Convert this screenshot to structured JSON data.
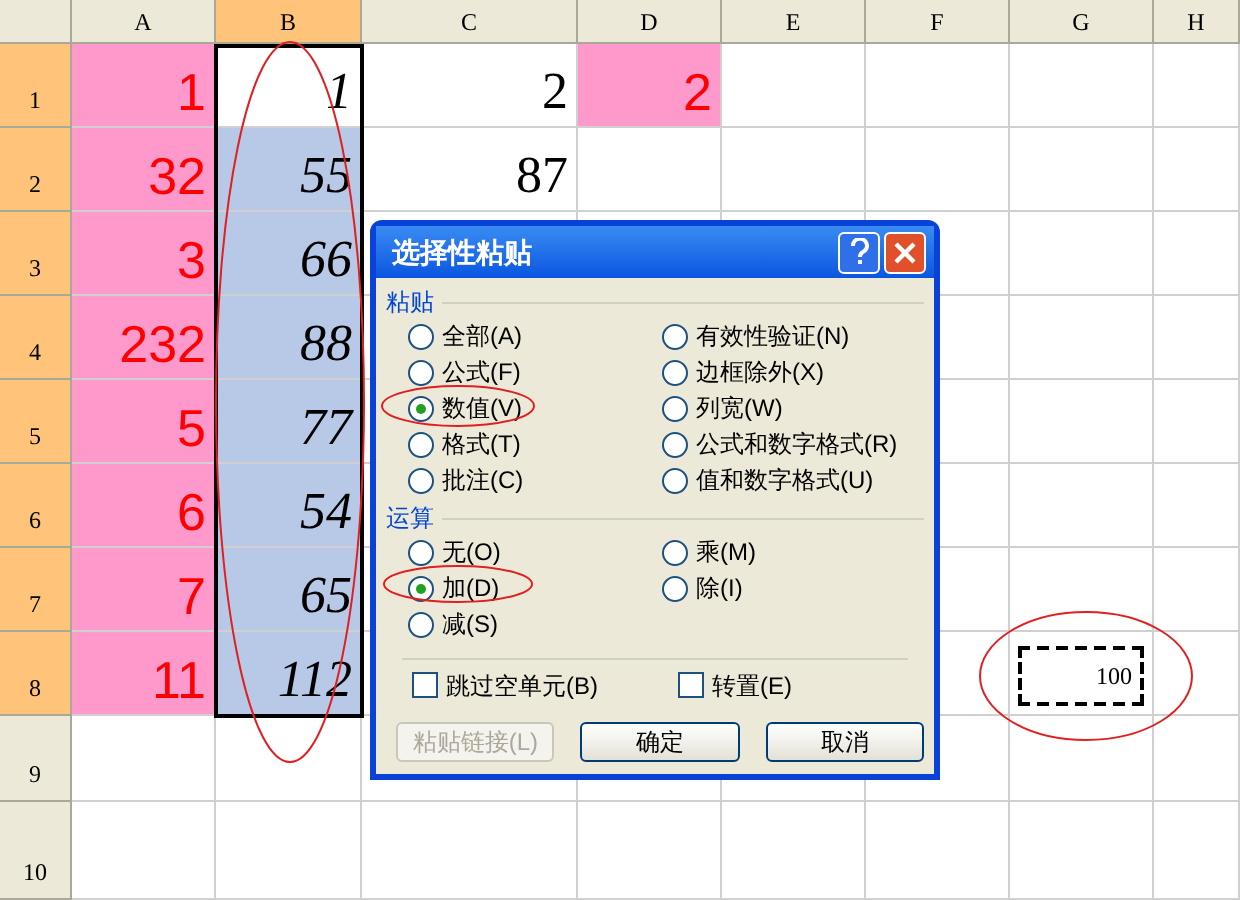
{
  "sheet": {
    "columns": [
      {
        "label": "A",
        "selected": false
      },
      {
        "label": "B",
        "selected": true
      },
      {
        "label": "C",
        "selected": false
      },
      {
        "label": "D",
        "selected": false
      },
      {
        "label": "E",
        "selected": false
      },
      {
        "label": "F",
        "selected": false
      },
      {
        "label": "G",
        "selected": false
      },
      {
        "label": "H",
        "selected": false
      }
    ],
    "rows": [
      {
        "label": "1",
        "selected": true,
        "cells": [
          {
            "kind": "highlight",
            "text": "1"
          },
          {
            "kind": "italic",
            "text": "1",
            "selected": false
          },
          {
            "kind": "number",
            "text": "2"
          },
          {
            "kind": "highlight",
            "text": "2"
          }
        ]
      },
      {
        "label": "2",
        "selected": true,
        "cells": [
          {
            "kind": "highlight",
            "text": "32"
          },
          {
            "kind": "italic",
            "text": "55",
            "selected": true
          },
          {
            "kind": "number",
            "text": "87"
          }
        ]
      },
      {
        "label": "3",
        "selected": true,
        "cells": [
          {
            "kind": "highlight",
            "text": "3"
          },
          {
            "kind": "italic",
            "text": "66",
            "selected": true
          }
        ]
      },
      {
        "label": "4",
        "selected": true,
        "cells": [
          {
            "kind": "highlight",
            "text": "232"
          },
          {
            "kind": "italic",
            "text": "88",
            "selected": true
          }
        ]
      },
      {
        "label": "5",
        "selected": true,
        "cells": [
          {
            "kind": "highlight",
            "text": "5"
          },
          {
            "kind": "italic",
            "text": "77",
            "selected": true
          }
        ]
      },
      {
        "label": "6",
        "selected": true,
        "cells": [
          {
            "kind": "highlight",
            "text": "6"
          },
          {
            "kind": "italic",
            "text": "54",
            "selected": true
          }
        ]
      },
      {
        "label": "7",
        "selected": true,
        "cells": [
          {
            "kind": "highlight",
            "text": "7"
          },
          {
            "kind": "italic",
            "text": "65",
            "selected": true
          }
        ]
      },
      {
        "label": "8",
        "selected": true,
        "cells": [
          {
            "kind": "highlight",
            "text": "11"
          },
          {
            "kind": "italic",
            "text": "112",
            "selected": true
          },
          {
            "kind": "empty"
          },
          {
            "kind": "empty"
          },
          {
            "kind": "empty"
          },
          {
            "kind": "empty"
          },
          {
            "kind": "copied",
            "text": "100"
          }
        ]
      },
      {
        "label": "9",
        "selected": false,
        "cells": []
      },
      {
        "label": "10",
        "selected": false,
        "cells": []
      }
    ]
  },
  "dialog": {
    "title": "选择性粘贴",
    "paste_group": {
      "label": "粘贴",
      "options": [
        {
          "label": "全部(A)",
          "selected": false
        },
        {
          "label": "有效性验证(N)",
          "selected": false
        },
        {
          "label": "公式(F)",
          "selected": false
        },
        {
          "label": "边框除外(X)",
          "selected": false
        },
        {
          "label": "数值(V)",
          "selected": true
        },
        {
          "label": "列宽(W)",
          "selected": false
        },
        {
          "label": "格式(T)",
          "selected": false
        },
        {
          "label": "公式和数字格式(R)",
          "selected": false
        },
        {
          "label": "批注(C)",
          "selected": false
        },
        {
          "label": "值和数字格式(U)",
          "selected": false
        }
      ]
    },
    "operation_group": {
      "label": "运算",
      "options": [
        {
          "label": "无(O)",
          "selected": false
        },
        {
          "label": "乘(M)",
          "selected": false
        },
        {
          "label": "加(D)",
          "selected": true
        },
        {
          "label": "除(I)",
          "selected": false
        },
        {
          "label": "减(S)",
          "selected": false
        }
      ]
    },
    "checkboxes": [
      {
        "label": "跳过空单元(B)",
        "checked": false
      },
      {
        "label": "转置(E)",
        "checked": false
      }
    ],
    "buttons": [
      {
        "label": "粘贴链接(L)",
        "disabled": true
      },
      {
        "label": "确定",
        "disabled": false
      },
      {
        "label": "取消",
        "disabled": false
      }
    ]
  }
}
